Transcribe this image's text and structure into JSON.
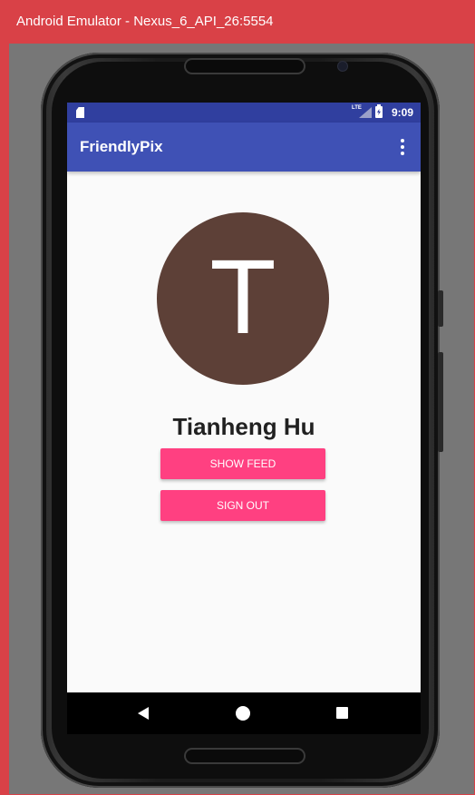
{
  "window": {
    "title": "Android Emulator - Nexus_6_API_26:5554"
  },
  "status_bar": {
    "network_label": "LTE",
    "time": "9:09"
  },
  "app_bar": {
    "title": "FriendlyPix",
    "menu_icon": "more-vert-icon"
  },
  "profile": {
    "avatar_letter": "T",
    "name": "Tianheng Hu"
  },
  "actions": {
    "show_feed_label": "SHOW FEED",
    "sign_out_label": "SIGN OUT"
  },
  "nav_bar": {
    "back_icon": "back-triangle-icon",
    "home_icon": "home-circle-icon",
    "recents_icon": "recents-square-icon"
  },
  "colors": {
    "title_bar": "#d94147",
    "status_bar": "#303f9f",
    "app_bar": "#3f51b5",
    "avatar": "#5d4037",
    "accent_button": "#ff4081",
    "screen_background": "#fafafa"
  }
}
